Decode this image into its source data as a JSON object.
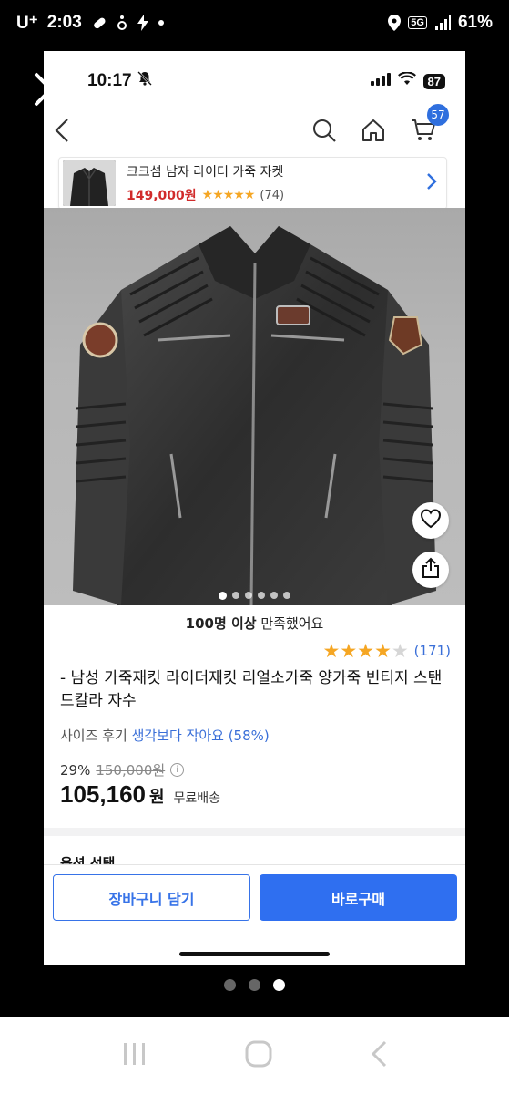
{
  "outer_status": {
    "carrier": "U⁺",
    "time": "2:03",
    "network": "5G",
    "battery": "61%"
  },
  "inner_status": {
    "time": "10:17",
    "battery": "87"
  },
  "nav": {
    "cart_count": "57"
  },
  "mini_product": {
    "title": "크크섬 남자 라이더 가죽 자켓",
    "price": "149,000원",
    "stars": "★★★★★",
    "review_count": "(74)"
  },
  "hero": {
    "dots_total": 6,
    "dots_active_index": 0
  },
  "satisfaction": {
    "bold": "100명 이상",
    "rest": " 만족했어요"
  },
  "rating": {
    "filled": "★★★★",
    "empty": "★",
    "count": "(171)"
  },
  "product": {
    "title": "- 남성 가죽재킷 라이더재킷 리얼소가죽 양가죽 빈티지 스탠드칼라 자수",
    "size_review_label": "사이즈 후기",
    "size_review_value": "생각보다 작아요 (58%)",
    "discount": "29%",
    "original_price": "150,000원",
    "final_price": "105,160",
    "currency": "원",
    "shipping": "무료배송"
  },
  "options": {
    "label": "옵션 선택"
  },
  "buttons": {
    "cart": "장바구니 담기",
    "buy": "바로구매"
  },
  "colors": {
    "primary_blue": "#2f6ff0",
    "price_red": "#d12b2b",
    "star_gold": "#f5a623"
  }
}
